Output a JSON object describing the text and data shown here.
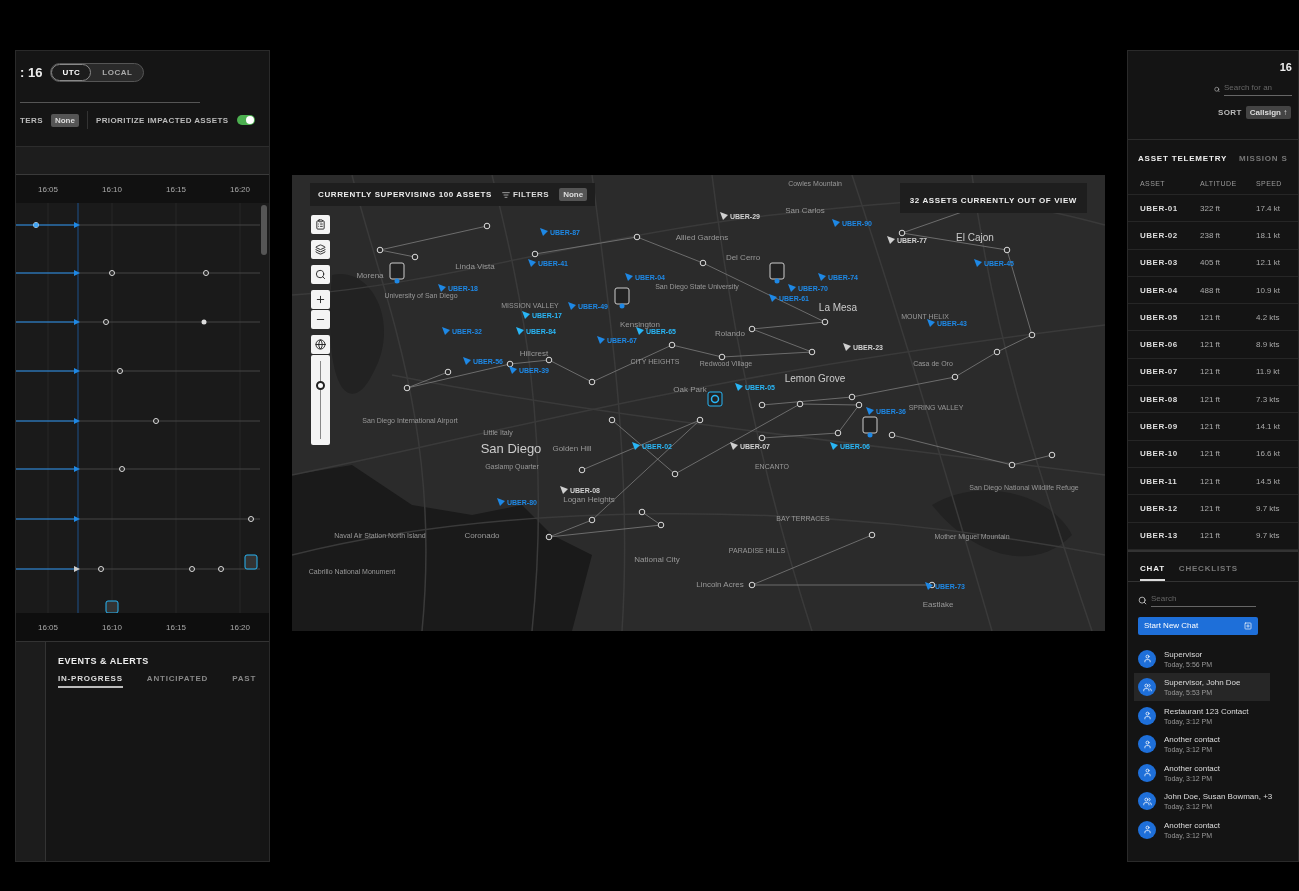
{
  "left_panel": {
    "clock": ": 16",
    "time_modes": [
      {
        "label": "UTC",
        "selected": true
      },
      {
        "label": "LOCAL",
        "selected": false
      }
    ],
    "filters_label": "TERS",
    "filters_value": "None",
    "prioritize": {
      "label": "PRIORITIZE IMPACTED ASSETS",
      "on": true
    },
    "timeline": {
      "top_ticks": [
        "16:05",
        "16:10",
        "16:15",
        "16:20"
      ],
      "bottom_ticks": [
        "16:05",
        "16:10",
        "16:15",
        "16:20"
      ]
    },
    "events": {
      "title": "EVENTS & ALERTS",
      "tabs": [
        {
          "label": "IN-PROGRESS",
          "selected": true
        },
        {
          "label": "ANTICIPATED",
          "selected": false
        },
        {
          "label": "PAST",
          "selected": false
        }
      ]
    }
  },
  "map": {
    "header": "CURRENTLY SUPERVISING 100 ASSETS",
    "filters_label": "FILTERS",
    "filters_value": "None",
    "out_of_view": "32 ASSETS CURRENTLY OUT OF VIEW",
    "zoom": {
      "level": 0.7
    },
    "places": [
      {
        "name": "Cowles Mountain",
        "kind": "small"
      },
      {
        "name": "San Carlos",
        "kind": "medium"
      },
      {
        "name": "Allied Gardens",
        "kind": "medium"
      },
      {
        "name": "El Cajon",
        "kind": "large"
      },
      {
        "name": "Del Cerro",
        "kind": "medium"
      },
      {
        "name": "Linda Vista",
        "kind": "medium"
      },
      {
        "name": "Morena",
        "kind": "medium"
      },
      {
        "name": "San Diego State University",
        "kind": "small"
      },
      {
        "name": "University of San Diego",
        "kind": "small"
      },
      {
        "name": "MISSION VALLEY",
        "kind": "small"
      },
      {
        "name": "La Mesa",
        "kind": "large"
      },
      {
        "name": "MOUNT HELIX",
        "kind": "small"
      },
      {
        "name": "Kensington",
        "kind": "medium"
      },
      {
        "name": "Rolando",
        "kind": "medium"
      },
      {
        "name": "Hillcrest",
        "kind": "medium"
      },
      {
        "name": "CITY HEIGHTS",
        "kind": "small"
      },
      {
        "name": "Redwood Village",
        "kind": "small"
      },
      {
        "name": "Casa de Oro",
        "kind": "small"
      },
      {
        "name": "Lemon Grove",
        "kind": "large"
      },
      {
        "name": "Oak Park",
        "kind": "medium"
      },
      {
        "name": "SPRING VALLEY",
        "kind": "small"
      },
      {
        "name": "San Diego International Airport",
        "kind": "small"
      },
      {
        "name": "Little Italy",
        "kind": "small"
      },
      {
        "name": "San Diego",
        "kind": "city"
      },
      {
        "name": "Golden Hill",
        "kind": "medium"
      },
      {
        "name": "Gaslamp Quarter",
        "kind": "small"
      },
      {
        "name": "ENCANTO",
        "kind": "small"
      },
      {
        "name": "San Diego National Wildlife Refuge",
        "kind": "small"
      },
      {
        "name": "Logan Heights",
        "kind": "medium"
      },
      {
        "name": "BAY TERRACES",
        "kind": "small"
      },
      {
        "name": "Naval Air Station North Island",
        "kind": "small"
      },
      {
        "name": "Coronado",
        "kind": "medium"
      },
      {
        "name": "Mother Miguel Mountain",
        "kind": "small"
      },
      {
        "name": "PARADISE HILLS",
        "kind": "small"
      },
      {
        "name": "National City",
        "kind": "medium"
      },
      {
        "name": "Cabrillo National Monument",
        "kind": "small"
      },
      {
        "name": "Lincoln Acres",
        "kind": "medium"
      },
      {
        "name": "Eastlake",
        "kind": "medium"
      }
    ],
    "assets": [
      {
        "label": "UBER-29",
        "color": "#d0d0d0"
      },
      {
        "label": "UBER-90",
        "color": "#1e88e5"
      },
      {
        "label": "UBER-87",
        "color": "#1e88e5"
      },
      {
        "label": "UBER-77",
        "color": "#d0d0d0"
      },
      {
        "label": "UBER-41",
        "color": "#1e88e5"
      },
      {
        "label": "UBER-45",
        "color": "#1e88e5"
      },
      {
        "label": "UBER-04",
        "color": "#1e88e5"
      },
      {
        "label": "UBER-74",
        "color": "#1e88e5"
      },
      {
        "label": "UBER-18",
        "color": "#1e88e5"
      },
      {
        "label": "UBER-70",
        "color": "#1e88e5"
      },
      {
        "label": "UBER-61",
        "color": "#1e88e5"
      },
      {
        "label": "UBER-49",
        "color": "#1e88e5"
      },
      {
        "label": "UBER-17",
        "color": "#29b6f6"
      },
      {
        "label": "UBER-43",
        "color": "#1e88e5"
      },
      {
        "label": "UBER-32",
        "color": "#1e88e5"
      },
      {
        "label": "UBER-84",
        "color": "#29b6f6"
      },
      {
        "label": "UBER-65",
        "color": "#29b6f6"
      },
      {
        "label": "UBER-67",
        "color": "#1e88e5"
      },
      {
        "label": "UBER-23",
        "color": "#d0d0d0"
      },
      {
        "label": "UBER-56",
        "color": "#1e88e5"
      },
      {
        "label": "UBER-39",
        "color": "#1e88e5"
      },
      {
        "label": "UBER-05",
        "color": "#29b6f6"
      },
      {
        "label": "UBER-36",
        "color": "#1e88e5"
      },
      {
        "label": "UBER-02",
        "color": "#29b6f6"
      },
      {
        "label": "UBER-07",
        "color": "#d0d0d0"
      },
      {
        "label": "UBER-06",
        "color": "#29b6f6"
      },
      {
        "label": "UBER-08",
        "color": "#d0d0d0"
      },
      {
        "label": "UBER-80",
        "color": "#1e88e5"
      },
      {
        "label": "UBER-73",
        "color": "#1e88e5"
      }
    ]
  },
  "right_panel": {
    "clock": "16",
    "search_placeholder": "Search for an",
    "sort_label": "SORT",
    "sort_value": "Callsign ↑",
    "tabs": [
      {
        "label": "ASSET TELEMETRY",
        "selected": true
      },
      {
        "label": "MISSION S",
        "selected": false
      }
    ],
    "columns": [
      "ASSET",
      "ALTITUDE",
      "SPEED"
    ],
    "rows": [
      [
        "UBER-01",
        "322 ft",
        "17.4 kt"
      ],
      [
        "UBER-02",
        "238 ft",
        "18.1 kt"
      ],
      [
        "UBER-03",
        "405 ft",
        "12.1 kt"
      ],
      [
        "UBER-04",
        "488 ft",
        "10.9 kt"
      ],
      [
        "UBER-05",
        "121 ft",
        "4.2 kts"
      ],
      [
        "UBER-06",
        "121 ft",
        "8.9 kts"
      ],
      [
        "UBER-07",
        "121 ft",
        "11.9 kt"
      ],
      [
        "UBER-08",
        "121 ft",
        "7.3 kts"
      ],
      [
        "UBER-09",
        "121 ft",
        "14.1 kt"
      ],
      [
        "UBER-10",
        "121 ft",
        "16.6 kt"
      ],
      [
        "UBER-11",
        "121 ft",
        "14.5 kt"
      ],
      [
        "UBER-12",
        "121 ft",
        "9.7 kts"
      ],
      [
        "UBER-13",
        "121 ft",
        "9.7 kts"
      ]
    ],
    "chat": {
      "tabs": [
        {
          "label": "CHAT",
          "selected": true
        },
        {
          "label": "CHECKLISTS",
          "selected": false
        }
      ],
      "search_placeholder": "Search",
      "new_chat": "Start New Chat",
      "contacts": [
        {
          "name": "Supervisor",
          "time": "Today, 5:56 PM",
          "kind": "person",
          "selected": false
        },
        {
          "name": "Supervisor, John Doe",
          "time": "Today, 5:53 PM",
          "kind": "group",
          "selected": true
        },
        {
          "name": "Restaurant 123 Contact",
          "time": "Today, 3:12 PM",
          "kind": "person",
          "selected": false
        },
        {
          "name": "Another contact",
          "time": "Today, 3:12 PM",
          "kind": "person",
          "selected": false
        },
        {
          "name": "Another contact",
          "time": "Today, 3:12 PM",
          "kind": "person",
          "selected": false
        },
        {
          "name": "John Doe, Susan Bowman, +3",
          "time": "Today, 3:12 PM",
          "kind": "group",
          "selected": false
        },
        {
          "name": "Another contact",
          "time": "Today, 3:12 PM",
          "kind": "person",
          "selected": false
        }
      ]
    }
  }
}
